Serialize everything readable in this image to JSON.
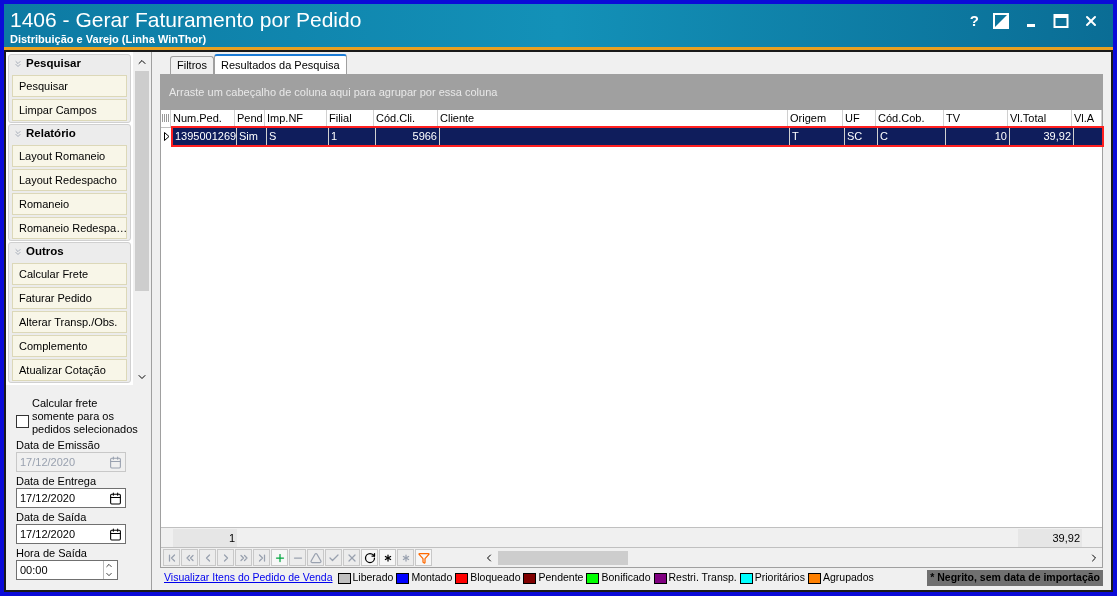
{
  "window": {
    "title": "1406 - Gerar Faturamento por Pedido",
    "subtitle": "Distribuição e Varejo (Linha WinThor)",
    "help": "?",
    "controls": [
      {
        "kind": "theme"
      },
      {
        "kind": "minimize"
      },
      {
        "kind": "maximize"
      },
      {
        "kind": "close"
      }
    ]
  },
  "sidebar": {
    "groups": [
      {
        "title": "Pesquisar",
        "items": [
          "Pesquisar",
          "Limpar Campos"
        ]
      },
      {
        "title": "Relatório",
        "items": [
          "Layout Romaneio",
          "Layout Redespacho",
          "Romaneio",
          "Romaneio Redespa…"
        ]
      },
      {
        "title": "Outros",
        "items": [
          "Calcular Frete",
          "Faturar Pedido",
          "Alterar Transp./Obs.",
          "Complemento",
          "Atualizar Cotação"
        ]
      }
    ],
    "checkbox": {
      "label": "Calcular frete somente para os pedidos selecionados",
      "checked": false
    },
    "dates": [
      {
        "label": "Data de Emissão",
        "value": "17/12/2020",
        "disabled": true
      },
      {
        "label": "Data de Entrega",
        "value": "17/12/2020",
        "disabled": false
      },
      {
        "label": "Data de Saída",
        "value": "17/12/2020",
        "disabled": false
      }
    ],
    "time": {
      "label": "Hora de Saída",
      "value": "00:00"
    }
  },
  "tabs": [
    {
      "label": "Filtros",
      "selected": false
    },
    {
      "label": "Resultados da Pesquisa",
      "selected": true
    }
  ],
  "group_hint": "Arraste um cabeçalho de coluna aqui para agrupar por essa coluna",
  "table": {
    "columns": [
      {
        "label": "Num.Ped.",
        "kind": "text"
      },
      {
        "label": "Pend",
        "kind": "text"
      },
      {
        "label": "Imp.NF",
        "kind": "text"
      },
      {
        "label": "Filial",
        "kind": "text"
      },
      {
        "label": "Cód.Cli.",
        "kind": "number"
      },
      {
        "label": "Cliente",
        "kind": "text"
      },
      {
        "label": "Origem",
        "kind": "text"
      },
      {
        "label": "UF",
        "kind": "text"
      },
      {
        "label": "Cód.Cob.",
        "kind": "text"
      },
      {
        "label": "TV",
        "kind": "number"
      },
      {
        "label": "Vl.Total",
        "kind": "number"
      },
      {
        "label": "Vl.A",
        "kind": "text"
      }
    ],
    "rows": [
      {
        "selected": true,
        "cells": [
          "1395001269",
          "Sim",
          "S",
          "1",
          "5966",
          "",
          "T",
          "SC",
          "C",
          "10",
          "39,92",
          ""
        ]
      }
    ],
    "summary": {
      "count": "1",
      "total": "39,92"
    }
  },
  "navigator": [
    {
      "kind": "first",
      "disabled": true
    },
    {
      "kind": "prev-page",
      "disabled": true
    },
    {
      "kind": "prev",
      "disabled": true
    },
    {
      "kind": "next",
      "disabled": true
    },
    {
      "kind": "next-page",
      "disabled": true
    },
    {
      "kind": "last",
      "disabled": true
    },
    {
      "kind": "add",
      "disabled": false
    },
    {
      "kind": "delete",
      "disabled": true
    },
    {
      "kind": "edit",
      "disabled": true
    },
    {
      "kind": "post",
      "disabled": true
    },
    {
      "kind": "cancel",
      "disabled": true
    },
    {
      "kind": "refresh",
      "disabled": false
    },
    {
      "kind": "bookmark",
      "disabled": false
    },
    {
      "kind": "goto-bookmark",
      "disabled": true
    },
    {
      "kind": "filter",
      "disabled": false
    }
  ],
  "link": "Visualizar Itens do Pedido de Venda",
  "legend": [
    {
      "label": "Liberado",
      "color": "#c0c0c0"
    },
    {
      "label": "Montado",
      "color": "#0000ff"
    },
    {
      "label": "Bloqueado",
      "color": "#ff0000"
    },
    {
      "label": "Pendente",
      "color": "#800000"
    },
    {
      "label": "Bonificado",
      "color": "#00ff00"
    },
    {
      "label": "Restri. Transp.",
      "color": "#800080"
    },
    {
      "label": "Prioritários",
      "color": "#00ffff"
    },
    {
      "label": "Agrupados",
      "color": "#ff8000"
    }
  ],
  "note": "* Negrito, sem data de importação"
}
